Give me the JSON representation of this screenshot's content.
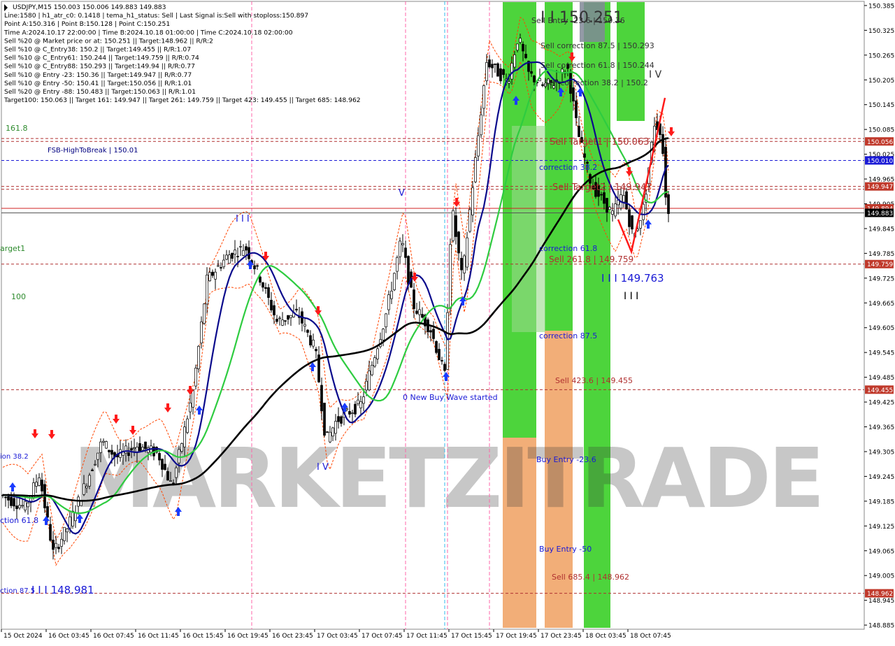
{
  "chart_data": {
    "type": "candlestick",
    "symbol": "USDJPY,M15",
    "header_lines": [
      "USDJPY,M15  150.003 150.006 149.883 149.883",
      "Line:1580 | h1_atr_c0: 0.1418 | tema_h1_status: Sell | Last Signal is:Sell with stoploss:150.897",
      "Point A:150.316 | Point B:150.128 | Point C:150.251",
      "Time A:2024.10.17 22:00:00 | Time B:2024.10.18 01:00:00 | Time C:2024.10.18 02:00:00",
      "Sell %20 @ Market price or at: 150.251 || Target:148.962 || R/R:2",
      "Sell %10 @ C_Entry38: 150.2 || Target:149.455 || R/R:1.07",
      "Sell %10 @ C_Entry61: 150.244 || Target:149.759 || R/R:0.74",
      "Sell %10 @ C_Entry88: 150.293 || Target:149.94 || R/R:0.77",
      "Sell %10 @ Entry -23: 150.36 || Target:149.947 || R/R:0.77",
      "Sell %10 @ Entry -50: 150.41 || Target:150.056 || R/R:1.01",
      "Sell %20 @ Entry -88: 150.483 || Target:150.063 || R/R:1.01",
      "Target100: 150.063 || Target 161: 149.947 || Target 261: 149.759 || Target 423: 149.455 || Target 685: 148.962"
    ],
    "y_ticks": [
      "150.385",
      "150.325",
      "150.265",
      "150.205",
      "150.145",
      "150.085",
      "150.025",
      "149.965",
      "149.905",
      "149.845",
      "149.785",
      "149.725",
      "149.665",
      "149.605",
      "149.545",
      "149.485",
      "149.425",
      "149.365",
      "149.305",
      "149.245",
      "149.185",
      "149.125",
      "149.065",
      "149.005",
      "148.945",
      "148.885"
    ],
    "ylim": [
      148.875,
      150.395
    ],
    "x_ticks": [
      "15 Oct 2024",
      "16 Oct 03:45",
      "16 Oct 07:45",
      "16 Oct 11:45",
      "16 Oct 15:45",
      "16 Oct 19:45",
      "16 Oct 23:45",
      "17 Oct 03:45",
      "17 Oct 07:45",
      "17 Oct 11:45",
      "17 Oct 15:45",
      "17 Oct 19:45",
      "17 Oct 23:45",
      "18 Oct 03:45",
      "18 Oct 07:45"
    ],
    "price_badges": [
      {
        "label": "150.056",
        "value": 150.056,
        "color": "#c0392b"
      },
      {
        "label": "150.010",
        "value": 150.01,
        "color": "#1a1ad6"
      },
      {
        "label": "149.947",
        "value": 149.947,
        "color": "#c0392b"
      },
      {
        "label": "149.894",
        "value": 149.894,
        "color": "#c0392b"
      },
      {
        "label": "149.883",
        "value": 149.883,
        "color": "#000000"
      },
      {
        "label": "149.759",
        "value": 149.759,
        "color": "#c0392b"
      },
      {
        "label": "149.455",
        "value": 149.455,
        "color": "#c0392b"
      },
      {
        "label": "148.962",
        "value": 148.962,
        "color": "#c0392b"
      }
    ],
    "hlines": [
      {
        "value": 150.063,
        "color": "#b03030",
        "style": "dash"
      },
      {
        "value": 150.056,
        "color": "#b03030",
        "style": "dash"
      },
      {
        "value": 150.01,
        "color": "#1a1ad6",
        "style": "dash"
      },
      {
        "value": 149.947,
        "color": "#b03030",
        "style": "dash"
      },
      {
        "value": 149.94,
        "color": "#b03030",
        "style": "dash"
      },
      {
        "value": 149.894,
        "color": "#d02020",
        "style": "solid"
      },
      {
        "value": 149.883,
        "color": "#555555",
        "style": "solid"
      },
      {
        "value": 149.759,
        "color": "#b03030",
        "style": "dash"
      },
      {
        "value": 149.455,
        "color": "#b03030",
        "style": "dash"
      },
      {
        "value": 148.962,
        "color": "#b03030",
        "style": "dash"
      }
    ],
    "annotations": [
      {
        "text": "FSB-HighToBreak | 150.01",
        "color": "#000080"
      },
      {
        "text": "161.8",
        "color": "#2e8b2e"
      },
      {
        "text": "100",
        "color": "#2e8b2e"
      },
      {
        "text": "arget1",
        "color": "#2e8b2e"
      },
      {
        "text": "ion 38.2",
        "color": "#1a1ad6"
      },
      {
        "text": "ction 61.8",
        "color": "#1a1ad6"
      },
      {
        "text": "ction 87.5",
        "color": "#1a1ad6"
      },
      {
        "text": "I I I 148.981",
        "color": "#1a1ad6"
      },
      {
        "text": "I I I",
        "color": "#1a1ad6"
      },
      {
        "text": "V",
        "color": "#1a1ad6"
      },
      {
        "text": "I V",
        "color": "#1a1ad6"
      },
      {
        "text": "0 New Buy Wave started",
        "color": "#1a1ad6"
      },
      {
        "text": "Sell Entry -23.6 | 150.36",
        "color": "#333333"
      },
      {
        "text": "I I 150.251",
        "color": "#333333"
      },
      {
        "text": "Sell correction 87.5 | 150.293",
        "color": "#333333"
      },
      {
        "text": "Sell correction 61.8 | 150.244",
        "color": "#333333"
      },
      {
        "text": "Sell correction 38.2 | 150.2",
        "color": "#333333"
      },
      {
        "text": "I V",
        "color": "#333333"
      },
      {
        "text": "Sell Target1 | 150.063",
        "color": "#b03030"
      },
      {
        "text": "correction 38.2",
        "color": "#1a1ad6"
      },
      {
        "text": "Sell Target2 | 149.947",
        "color": "#b03030"
      },
      {
        "text": "correction 61.8",
        "color": "#1a1ad6"
      },
      {
        "text": "Sell 261.8 | 149.759",
        "color": "#b03030"
      },
      {
        "text": "I I I 149.763",
        "color": "#1a1ad6"
      },
      {
        "text": "I I I",
        "color": "#000000"
      },
      {
        "text": "correction 87.5",
        "color": "#1a1ad6"
      },
      {
        "text": "Sell 423.6 | 149.455",
        "color": "#b03030"
      },
      {
        "text": "Buy Entry -23.6",
        "color": "#1a1ad6"
      },
      {
        "text": "Buy Entry -50",
        "color": "#1a1ad6"
      },
      {
        "text": "Sell 685.4 | 148.962",
        "color": "#b03030"
      }
    ],
    "watermark": "MARKETZITRADE",
    "colors": {
      "bull_candle": "#000000",
      "bear_candle": "#000000",
      "ma_slow": "#000000",
      "ma_mid": "#2ecc40",
      "ma_fast": "#0a0a8c",
      "band": "#ff4500",
      "zone_green": "#2ecc1a",
      "zone_orange": "#f0a060",
      "zone_gray": "#808896",
      "arrow_up": "#1a3cff",
      "arrow_down": "#ff1a1a"
    }
  }
}
